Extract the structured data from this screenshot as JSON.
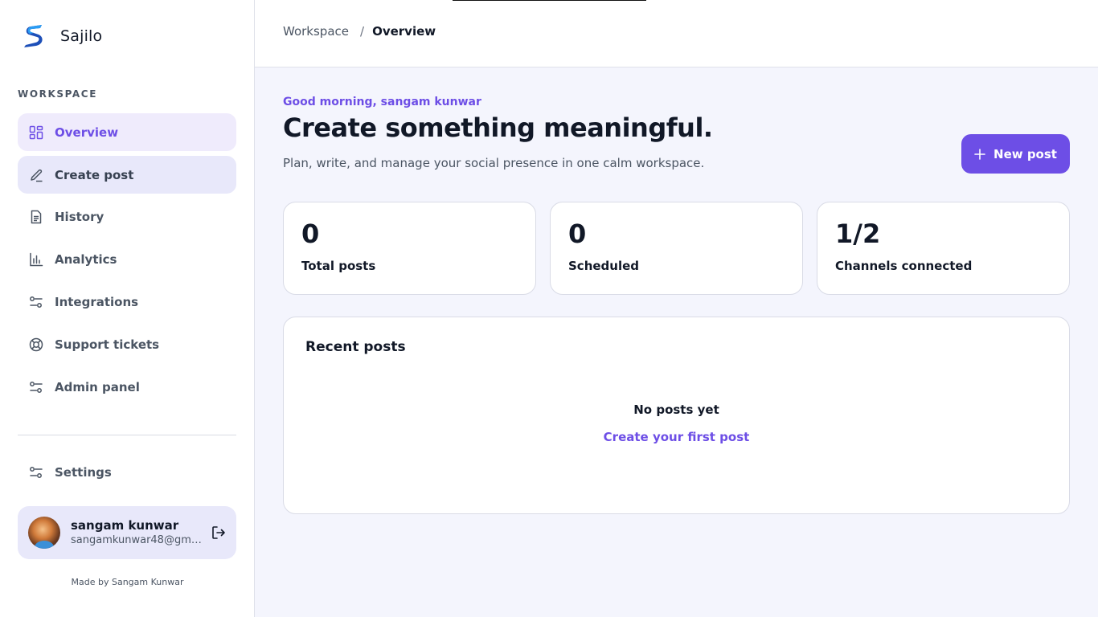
{
  "brand": {
    "name": "Sajilo",
    "logo_icon": "sajilo-logo-icon"
  },
  "sidebar": {
    "section_label": "WORKSPACE",
    "items": [
      {
        "label": "Overview",
        "icon": "grid-icon",
        "state": "active"
      },
      {
        "label": "Create post",
        "icon": "pencil-icon",
        "state": "hover"
      },
      {
        "label": "History",
        "icon": "document-icon",
        "state": ""
      },
      {
        "label": "Analytics",
        "icon": "bar-chart-icon",
        "state": ""
      },
      {
        "label": "Integrations",
        "icon": "sliders-icon",
        "state": ""
      },
      {
        "label": "Support tickets",
        "icon": "lifebuoy-icon",
        "state": ""
      },
      {
        "label": "Admin panel",
        "icon": "sliders-icon",
        "state": ""
      }
    ],
    "settings": {
      "label": "Settings",
      "icon": "sliders-icon"
    }
  },
  "user": {
    "name": "sangam kunwar",
    "email": "sangamkunwar48@gma...",
    "logout_icon": "logout-icon"
  },
  "footer": {
    "made_by": "Made by Sangam Kunwar"
  },
  "breadcrumb": {
    "root": "Workspace",
    "separator": "/",
    "current": "Overview"
  },
  "hero": {
    "greeting": "Good morning, sangam kunwar",
    "headline": "Create something meaningful.",
    "subhead": "Plan, write, and manage your social presence in one calm workspace.",
    "new_post_label": "New post"
  },
  "stats": [
    {
      "value": "0",
      "label": "Total posts"
    },
    {
      "value": "0",
      "label": "Scheduled"
    },
    {
      "value": "1/2",
      "label": "Channels connected"
    }
  ],
  "recent_posts": {
    "title": "Recent posts",
    "empty_title": "No posts yet",
    "empty_link": "Create your first post"
  },
  "colors": {
    "accent": "#6d4ee6",
    "background": "#f4f5fd",
    "active_nav_bg": "#efebfc",
    "hover_nav_bg": "#e8e8fa"
  }
}
